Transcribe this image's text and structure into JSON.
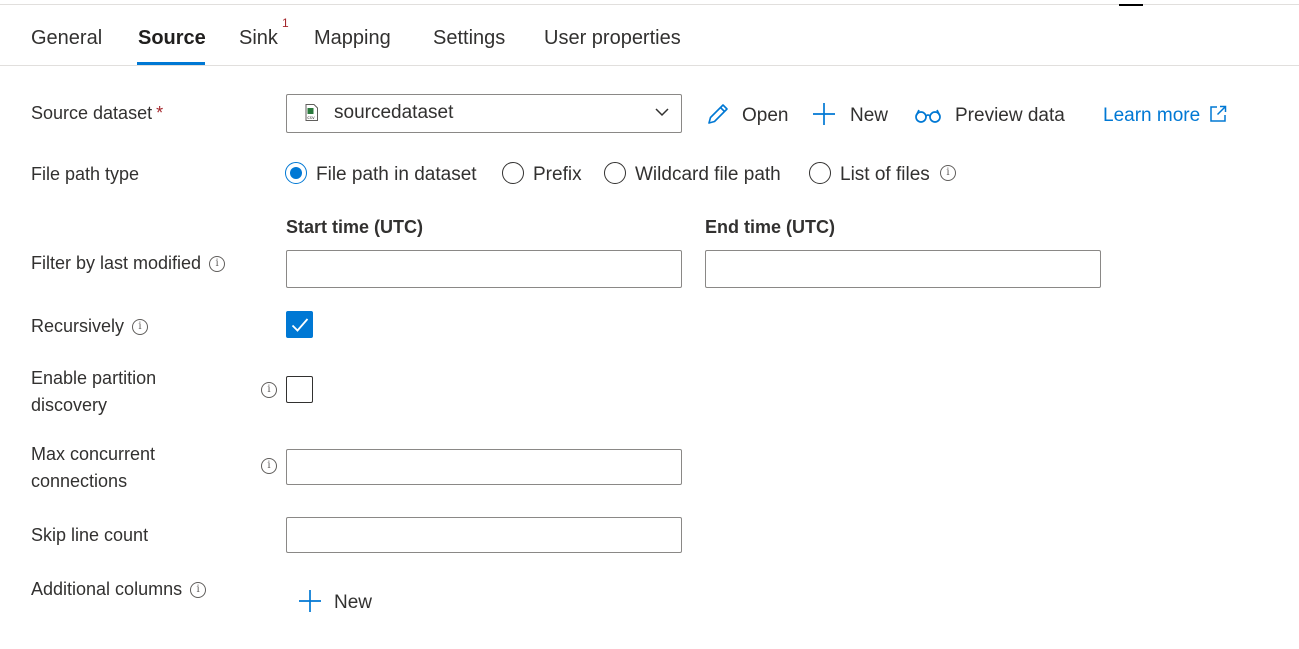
{
  "tabs": [
    {
      "label": "General"
    },
    {
      "label": "Source",
      "active": true
    },
    {
      "label": "Sink",
      "badge": "1"
    },
    {
      "label": "Mapping"
    },
    {
      "label": "Settings"
    },
    {
      "label": "User properties"
    }
  ],
  "source_dataset": {
    "label": "Source dataset",
    "required_mark": "*",
    "value": "sourcedataset",
    "icon": "csv-file-icon",
    "actions": {
      "open": "Open",
      "new": "New",
      "preview": "Preview data",
      "learn_more": "Learn more"
    }
  },
  "file_path_type": {
    "label": "File path type",
    "options": [
      "File path in dataset",
      "Prefix",
      "Wildcard file path",
      "List of files"
    ],
    "selected": "File path in dataset"
  },
  "filter_last_modified": {
    "label": "Filter by last modified",
    "start_label": "Start time (UTC)",
    "end_label": "End time (UTC)",
    "start_value": "",
    "end_value": ""
  },
  "recursively": {
    "label": "Recursively",
    "checked": true
  },
  "partition_discovery": {
    "label_line1": "Enable partition",
    "label_line2": "discovery",
    "checked": false
  },
  "max_concurrent": {
    "label_line1": "Max concurrent",
    "label_line2": "connections",
    "value": ""
  },
  "skip_line_count": {
    "label": "Skip line count",
    "value": ""
  },
  "additional_columns": {
    "label": "Additional columns",
    "new_label": "New"
  },
  "colors": {
    "accent": "#0078d4",
    "required": "#a4262c",
    "text": "#323130"
  }
}
